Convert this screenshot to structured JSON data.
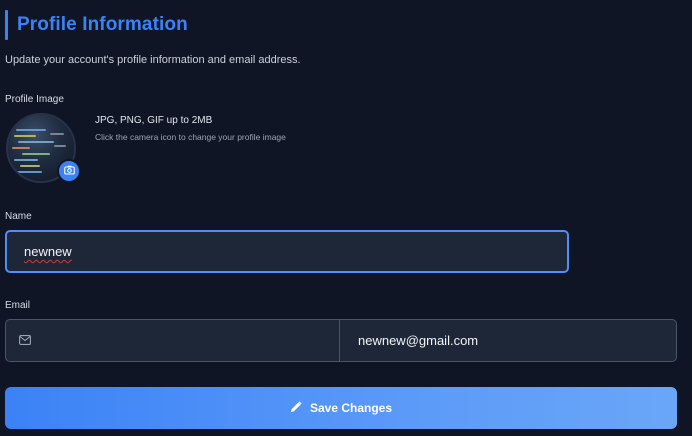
{
  "header": {
    "title": "Profile Information",
    "subtitle": "Update your account's profile information and email address."
  },
  "profile_image": {
    "label": "Profile Image",
    "hint_formats": "JPG, PNG, GIF up to 2MB",
    "hint_action": "Click the camera icon to change your profile image"
  },
  "name_field": {
    "label": "Name",
    "value": "newnew"
  },
  "email_field": {
    "label": "Email",
    "value": "newnew@gmail.com"
  },
  "actions": {
    "save_label": "Save Changes"
  },
  "colors": {
    "background": "#0f1524",
    "accent": "#3b82f6",
    "input_bg": "#1d2738",
    "input_border": "#4a5568"
  }
}
